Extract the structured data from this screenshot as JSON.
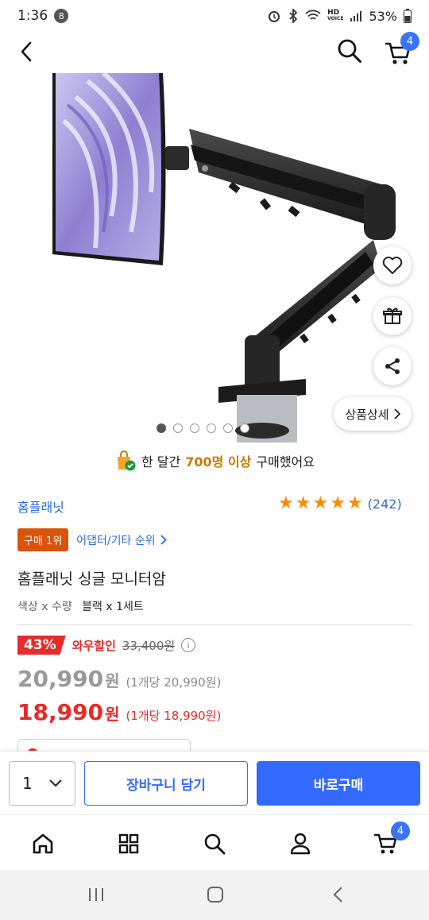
{
  "status_bar": {
    "time": "1:36",
    "notification_count": "8",
    "hd_label": "HD",
    "voice_label": "VOICE",
    "battery": "53%"
  },
  "header": {
    "cart_badge": "4"
  },
  "hero": {
    "detail_button_label": "상품상세",
    "dot_count": 6,
    "active_dot": 0
  },
  "purchase_notice": {
    "prefix": "한 달간",
    "highlight": "700명 이상",
    "suffix": "구매했어요"
  },
  "product": {
    "brand": "홈플래닛",
    "rating_stars": 5,
    "review_count": "(242)",
    "rank_badge": "구매 1위",
    "rank_category": "어댑터/기타 순위",
    "title": "홈플래닛 싱글 모니터암",
    "option_label": "색상 x 수량",
    "option_value": "블랙 x 1세트"
  },
  "pricing": {
    "discount_pct": "43%",
    "discount_label": "와우할인",
    "original_price": "33,400원",
    "price_number": "20,990",
    "price_currency": "원",
    "price_unit": "(1개당 20,990원)",
    "wow_price_number": "18,990",
    "wow_price_currency": "원",
    "wow_price_unit": "(1개당 18,990원)"
  },
  "buy_bar": {
    "quantity": "1",
    "add_to_cart": "장바구니 담기",
    "buy_now": "바로구매"
  },
  "tab_bar": {
    "cart_badge": "4"
  },
  "colors": {
    "accent_blue": "#346aff",
    "sale_red": "#e62b2b",
    "rank_orange": "#d9540a",
    "star_orange": "#ff8a00"
  }
}
